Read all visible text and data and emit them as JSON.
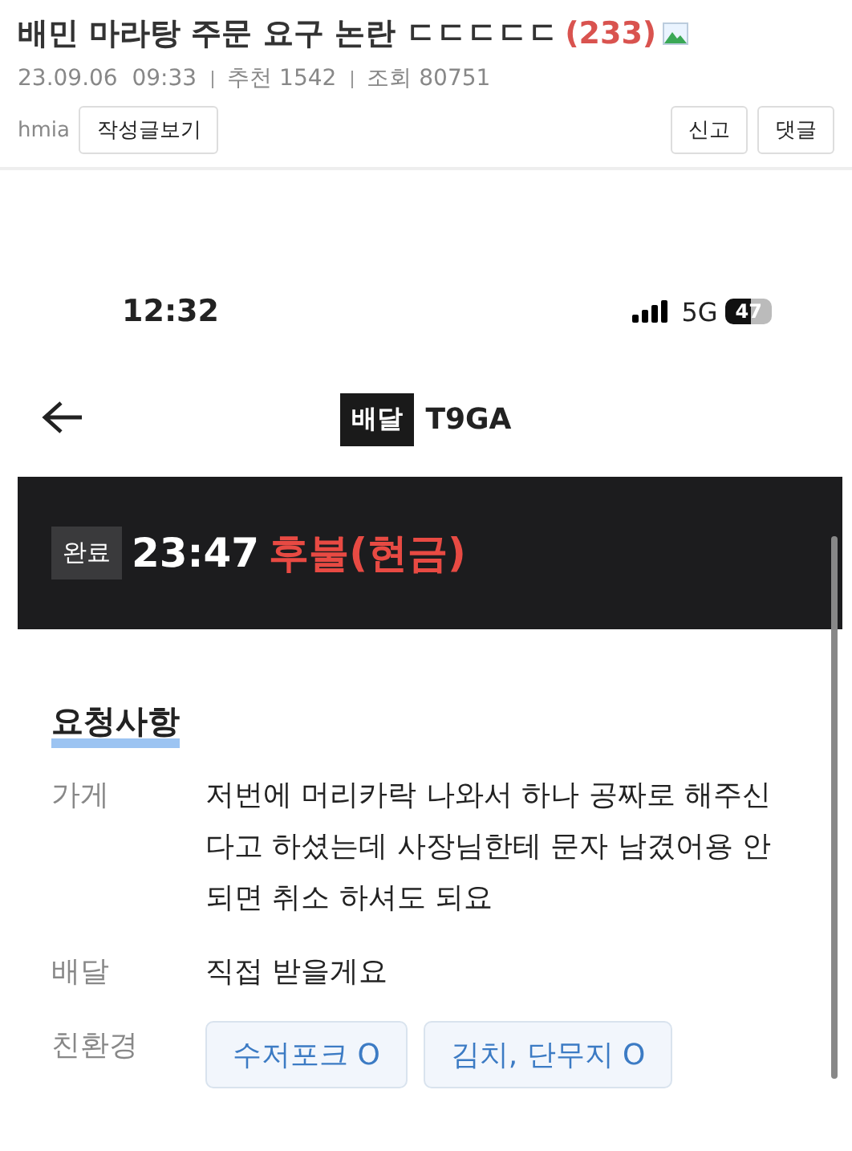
{
  "post": {
    "title": "배민 마라탕 주문 요구 논란 ㄷㄷㄷㄷㄷ",
    "comment_count": "(233)",
    "date": "23.09.06",
    "time": "09:33",
    "recommend_label": "추천",
    "recommend": "1542",
    "views_label": "조회",
    "views": "80751",
    "author": "hmia",
    "author_button": "작성글보기",
    "buttons": [
      "신고",
      "댓글"
    ]
  },
  "screenshot": {
    "status_bar": {
      "time": "12:32",
      "network": "5G",
      "battery": "47"
    },
    "nav": {
      "tag": "배달",
      "code": "T9GA"
    },
    "banner": {
      "status": "완료",
      "time": "23:47",
      "payment": "후불(현금)"
    },
    "request": {
      "heading": "요청사항",
      "rows": [
        {
          "kind": "text",
          "label": "가게",
          "text": "저번에 머리카락 나와서 하나 공짜로 해주신다고 하셨는데 사장님한테 문자 남겼어용 안되면 취소 하셔도 되요"
        },
        {
          "kind": "text",
          "label": "배달",
          "text": "직접 받을게요"
        },
        {
          "kind": "chips",
          "label": "친환경",
          "chips": [
            "수저포크 O",
            "김치, 단무지 O"
          ]
        }
      ]
    }
  }
}
